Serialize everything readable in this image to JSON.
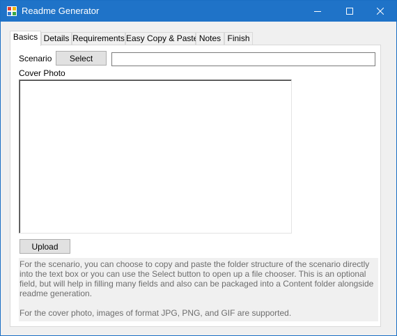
{
  "window": {
    "title": "Readme Generator",
    "controls": {
      "minimize": "minimize-icon",
      "maximize": "maximize-icon",
      "close": "close-icon"
    }
  },
  "tabs": [
    {
      "label": "Basics",
      "active": true
    },
    {
      "label": "Details",
      "active": false
    },
    {
      "label": "Requirements",
      "active": false
    },
    {
      "label": "Easy Copy & Paste",
      "active": false
    },
    {
      "label": "Notes",
      "active": false
    },
    {
      "label": "Finish",
      "active": false
    }
  ],
  "basics": {
    "scenario_label": "Scenario",
    "select_button": "Select",
    "scenario_value": "",
    "cover_photo_label": "Cover Photo",
    "upload_button": "Upload",
    "help_text": [
      "For the scenario, you can choose to copy and paste the folder structure of the scenario directly into the text box or you can use the Select button to open up a file chooser. This is an optional field, but will help in filling many fields and also can be packaged into a Content folder alongside readme generation.",
      "For the cover photo, images of format JPG, PNG, and GIF are supported."
    ]
  },
  "colors": {
    "titlebar": "#1f73c8",
    "window_bg": "#f0f0f0",
    "button_bg": "#e1e1e1",
    "help_text": "#6d6d6d"
  }
}
